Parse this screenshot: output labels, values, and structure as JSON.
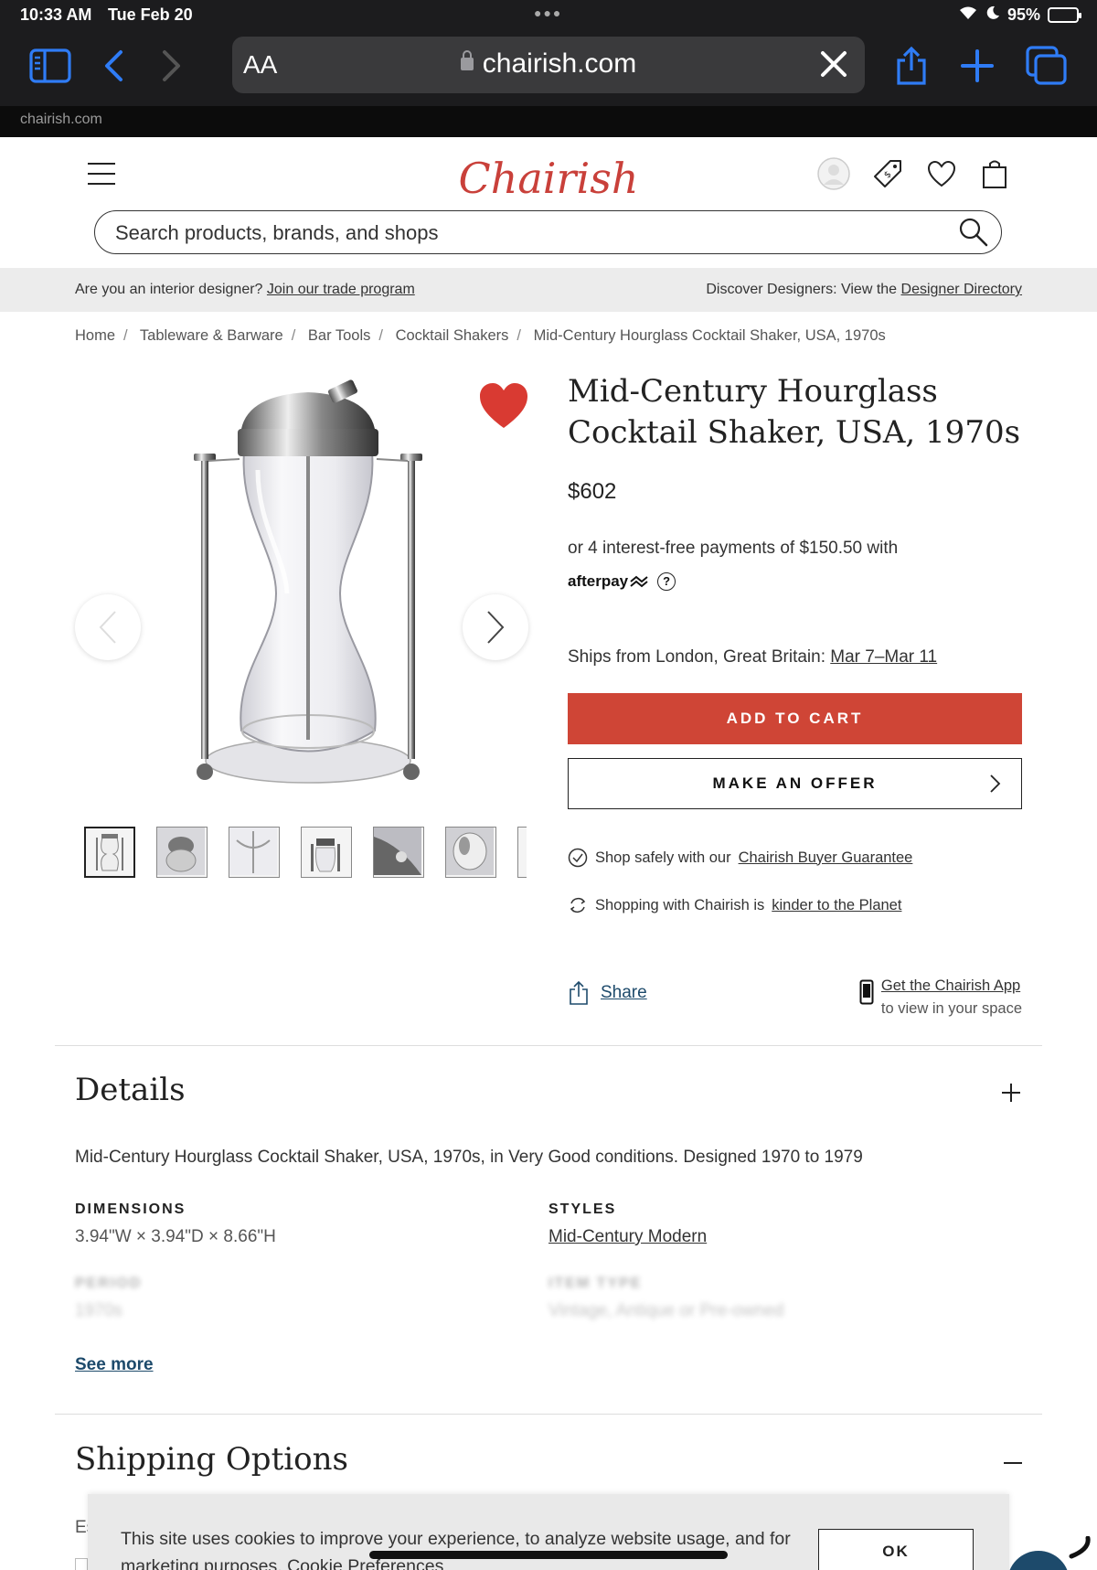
{
  "status_bar": {
    "time": "10:33 AM",
    "date": "Tue Feb 20",
    "battery": "95%",
    "battery_level": 0.95
  },
  "browser": {
    "aa_label": "AA",
    "url": "chairish.com",
    "tab_label": "chairish.com"
  },
  "header": {
    "logo": "Chairish",
    "search_placeholder": "Search products, brands, and shops"
  },
  "trade_bar": {
    "left_text": "Are you an interior designer?",
    "left_link": "Join our trade program",
    "right_text": "Discover Designers: View the",
    "right_link": "Designer Directory"
  },
  "breadcrumb": [
    "Home",
    "Tableware & Barware",
    "Bar Tools",
    "Cocktail Shakers",
    "Mid-Century Hourglass Cocktail Shaker, USA, 1970s"
  ],
  "product": {
    "title": "Mid-Century Hourglass Cocktail Shaker, USA, 1970s",
    "price": "$602",
    "installments": "or 4 interest-free payments of $150.50 with",
    "afterpay": "afterpay",
    "ships_text": "Ships from London, Great Britain:",
    "ships_dates": "Mar 7–Mar 11",
    "add_to_cart": "ADD TO CART",
    "make_offer": "MAKE AN OFFER",
    "guarantee_text": "Shop safely with our",
    "guarantee_link": "Chairish Buyer Guarantee",
    "planet_text": "Shopping with Chairish is",
    "planet_link": "kinder to the Planet",
    "share": "Share",
    "app_link": "Get the Chairish App",
    "app_sub": "to view in your space"
  },
  "details": {
    "title": "Details",
    "description": "Mid-Century Hourglass Cocktail Shaker, USA, 1970s, in Very Good conditions. Designed 1970 to 1979",
    "dimensions_label": "DIMENSIONS",
    "dimensions_value": "3.94\"W × 3.94\"D × 8.66\"H",
    "styles_label": "STYLES",
    "styles_value": "Mid-Century Modern",
    "period_label": "PERIOD",
    "period_value": "1970s",
    "item_type_label": "ITEM TYPE",
    "item_type_value": "Vintage, Antique or Pre-owned",
    "see_more": "See more"
  },
  "shipping": {
    "title": "Shipping Options",
    "peek": "Es"
  },
  "cookie": {
    "text": "This site uses cookies to improve your experience, to analyze website usage, and for marketing purposes. Cookie Preferences",
    "ok": "OK"
  },
  "colors": {
    "accent": "#cf4536",
    "logo": "#c9403a",
    "link": "#1d4a6b",
    "safari_blue": "#2f7cf6"
  }
}
